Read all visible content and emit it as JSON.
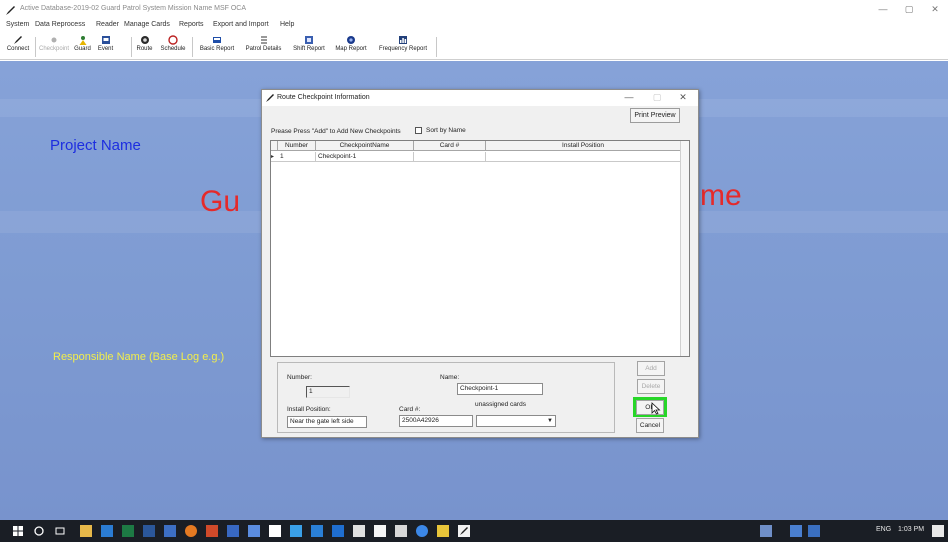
{
  "window": {
    "title": "Active Database-2019-02  Guard Patrol System Mission Name   MSF OCA",
    "controls": [
      "—",
      "▢",
      "✕"
    ]
  },
  "menu": [
    "System",
    "Data Reprocess",
    "Reader",
    "Manage Cards",
    "Reports",
    "Export and Import",
    "Help"
  ],
  "toolbar": [
    {
      "label": "Connect",
      "icon": "pen-icon",
      "enabled": true
    },
    {
      "label": "Checkpoint",
      "icon": "checkpoint-icon",
      "enabled": false
    },
    {
      "label": "Guard",
      "icon": "guard-icon",
      "enabled": true
    },
    {
      "label": "Event",
      "icon": "event-icon",
      "enabled": true
    },
    {
      "label": "Route",
      "icon": "route-icon",
      "enabled": true
    },
    {
      "label": "Schedule",
      "icon": "schedule-icon",
      "enabled": true
    },
    {
      "label": "Basic Report",
      "icon": "report-icon",
      "enabled": true
    },
    {
      "label": "Patrol Details",
      "icon": "details-icon",
      "enabled": true
    },
    {
      "label": "Shift Report",
      "icon": "shift-icon",
      "enabled": true
    },
    {
      "label": "Map Report",
      "icon": "map-icon",
      "enabled": true
    },
    {
      "label": "Frequency Report",
      "icon": "frequency-icon",
      "enabled": true
    }
  ],
  "background": {
    "project_name": "Project Name",
    "big_left": "Gu",
    "big_right": "me",
    "responsible": "Responsible Name (Base Log e.g.)"
  },
  "dialog": {
    "title": "Route Checkpoint Information",
    "print_preview": "Print Preview",
    "hint": "Prease Press \"Add\" to Add New Checkpoints",
    "sort_label": "Sort by Name",
    "columns": [
      "Number",
      "CheckpointName",
      "Card #",
      "Install Position"
    ],
    "rows": [
      {
        "indicator": "▸",
        "number": "1",
        "name": "Checkpoint-1",
        "card": "",
        "position": ""
      }
    ],
    "form": {
      "number_label": "Number:",
      "number_value": "1",
      "name_label": "Name:",
      "name_value": "Checkpoint-1",
      "install_label": "Install Position:",
      "install_value": "Near the gate left side",
      "card_label": "Card #:",
      "card_value": "2500A42926",
      "unassigned_label": "unassigned cards",
      "unassigned_value": ""
    },
    "buttons": {
      "add": "Add",
      "delete": "Delete",
      "ok": "OK",
      "cancel": "Cancel"
    }
  },
  "taskbar": {
    "tray": "ENG",
    "time": "1:03 PM"
  },
  "colors": {
    "background_blue": "#7e9bd2",
    "project_name": "#1d2ee0",
    "big_title": "#e52a2a",
    "responsible": "#f2ee4a",
    "highlight": "#27d628"
  }
}
